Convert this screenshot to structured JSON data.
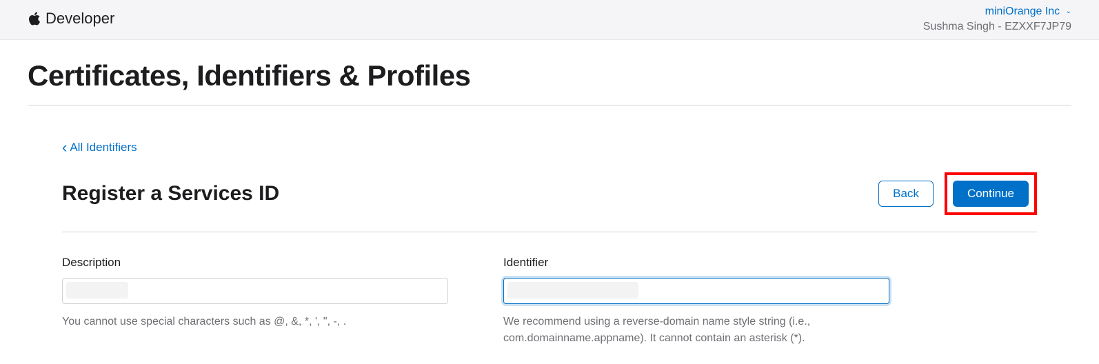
{
  "topbar": {
    "brand": "Developer",
    "team": "miniOrange Inc",
    "user_line": "Sushma Singh - EZXXF7JP79"
  },
  "page": {
    "title": "Certificates, Identifiers & Profiles"
  },
  "content": {
    "back_link": "All Identifiers",
    "section_title": "Register a Services ID",
    "buttons": {
      "back": "Back",
      "continue": "Continue"
    },
    "form": {
      "description": {
        "label": "Description",
        "value": "",
        "help": "You cannot use special characters such as @, &, *, ', \", -, ."
      },
      "identifier": {
        "label": "Identifier",
        "value": "",
        "help": "We recommend using a reverse-domain name style string (i.e., com.domainname.appname). It cannot contain an asterisk (*)."
      }
    }
  }
}
